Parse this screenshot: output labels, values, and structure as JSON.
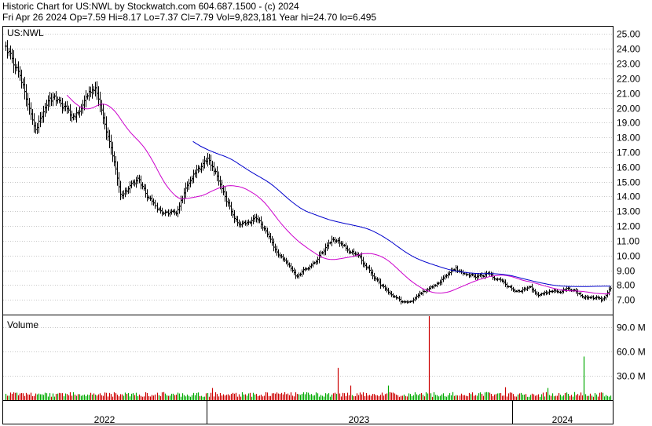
{
  "header": {
    "line1": "Historic Chart for US:NWL by Stockwatch.com 604.687.1500 - (c) 2024",
    "line2": "Fri Apr 26 2024   Op=7.59   Hi=8.17   Lo=7.37   Cl=7.79   Vol=9,823,181   Year hi=24.70   lo=6.495"
  },
  "chart_data": [
    {
      "type": "candlestick",
      "title": "US:NWL",
      "ylim": [
        6.0,
        25.5
      ],
      "y_ticks": [
        "25.00",
        "24.00",
        "23.00",
        "22.00",
        "21.00",
        "20.00",
        "19.00",
        "18.00",
        "17.00",
        "16.00",
        "15.00",
        "14.00",
        "13.00",
        "12.00",
        "11.00",
        "10.00",
        "9.00",
        "8.00",
        "7.00"
      ],
      "x_ticks": [
        "2022",
        "2023",
        "2024"
      ],
      "price_keypoints": {
        "t": [
          0,
          0.02,
          0.05,
          0.08,
          0.11,
          0.15,
          0.19,
          0.22,
          0.25,
          0.28,
          0.31,
          0.335,
          0.36,
          0.385,
          0.42,
          0.45,
          0.48,
          0.51,
          0.54,
          0.565,
          0.585,
          0.62,
          0.655,
          0.68,
          0.71,
          0.745,
          0.76,
          0.8,
          0.84,
          0.865,
          0.88,
          0.905,
          0.93,
          0.955,
          0.985,
          1.0
        ],
        "close": [
          24.2,
          22.5,
          19.0,
          20.5,
          19.5,
          21.2,
          14.0,
          15.0,
          13.0,
          12.8,
          15.5,
          16.5,
          14.5,
          12.0,
          12.5,
          10.0,
          8.5,
          9.5,
          11.0,
          10.5,
          10.0,
          8.0,
          6.8,
          7.2,
          8.0,
          9.0,
          8.6,
          8.7,
          7.5,
          7.7,
          7.4,
          7.6,
          7.8,
          7.3,
          7.0,
          7.79
        ]
      },
      "moving_averages": [
        {
          "color": "#cc00cc",
          "window": 40
        },
        {
          "color": "#0000cc",
          "window": 120
        }
      ]
    },
    {
      "type": "bar",
      "title": "Volume",
      "ylim": [
        0,
        105
      ],
      "unit": "M",
      "y_ticks": [
        "90.0 M",
        "60.0 M",
        "30.0 M"
      ],
      "typical_volume": [
        4,
        10
      ],
      "spikes": [
        {
          "t": 0.34,
          "value": 15,
          "color": "#cc0000"
        },
        {
          "t": 0.55,
          "value": 40,
          "color": "#cc0000"
        },
        {
          "t": 0.57,
          "value": 18,
          "color": "#cc0000"
        },
        {
          "t": 0.633,
          "value": 18,
          "color": "#00aa00"
        },
        {
          "t": 0.7,
          "value": 105,
          "color": "#cc0000"
        },
        {
          "t": 0.825,
          "value": 16,
          "color": "#cc0000"
        },
        {
          "t": 0.897,
          "value": 15,
          "color": "#00aa00"
        },
        {
          "t": 0.955,
          "value": 54,
          "color": "#00aa00"
        }
      ],
      "colors": {
        "up": "#00aa00",
        "down": "#cc0000"
      }
    }
  ]
}
